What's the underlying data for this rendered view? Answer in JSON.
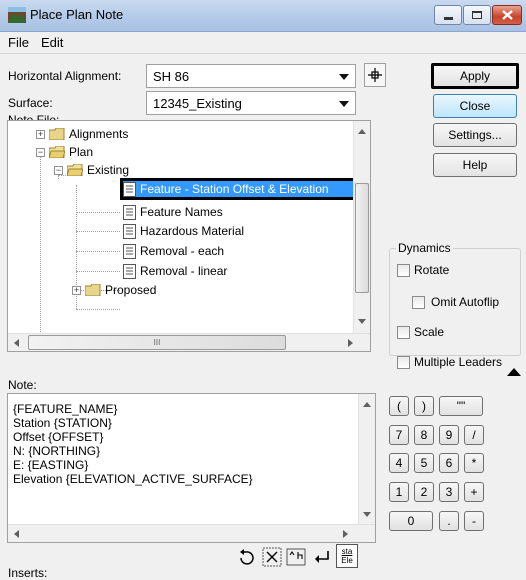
{
  "window": {
    "title": "Place Plan Note"
  },
  "menu": [
    "File",
    "Edit"
  ],
  "form": {
    "horizontal_alignment_label": "Horizontal Alignment:",
    "horizontal_alignment_value": "SH 86",
    "surface_label": "Surface:",
    "surface_value": "12345_Existing",
    "note_file_label": "Note File:"
  },
  "buttons": {
    "apply": "Apply",
    "close": "Close",
    "settings": "Settings...",
    "help": "Help"
  },
  "tree": {
    "alignments": "Alignments",
    "plan": "Plan",
    "existing": "Existing",
    "items": [
      "Feature - Station Offset & Elevation",
      "Feature Names",
      "Hazardous Material",
      "Removal - each",
      "Removal - linear"
    ],
    "proposed": "Proposed",
    "hscroll_grip": "III"
  },
  "dynamics": {
    "label": "Dynamics",
    "rotate": "Rotate",
    "omit_autoflip": "Omit Autoflip",
    "scale": "Scale",
    "multiple_leaders": "Multiple Leaders"
  },
  "note": {
    "label": "Note:",
    "lines": [
      "{FEATURE_NAME}",
      "Station {STATION}",
      "Offset {OFFSET}",
      "N:  {NORTHING}",
      "E:  {EASTING}",
      "Elevation  {ELEVATION_ACTIVE_SURFACE}"
    ]
  },
  "keypad": {
    "row1": [
      "(",
      ")",
      "\"\""
    ],
    "row2": [
      "7",
      "8",
      "9",
      "/"
    ],
    "row3": [
      "4",
      "5",
      "6",
      "*"
    ],
    "row4": [
      "1",
      "2",
      "3",
      "+"
    ],
    "row5": [
      "0",
      ".",
      "-"
    ]
  },
  "inserts": {
    "label": "Inserts:",
    "sta_top": "sta",
    "sta_bottom": "Ele"
  },
  "colors": {
    "selection": "#3399ff",
    "highlight_border": "#000000"
  }
}
